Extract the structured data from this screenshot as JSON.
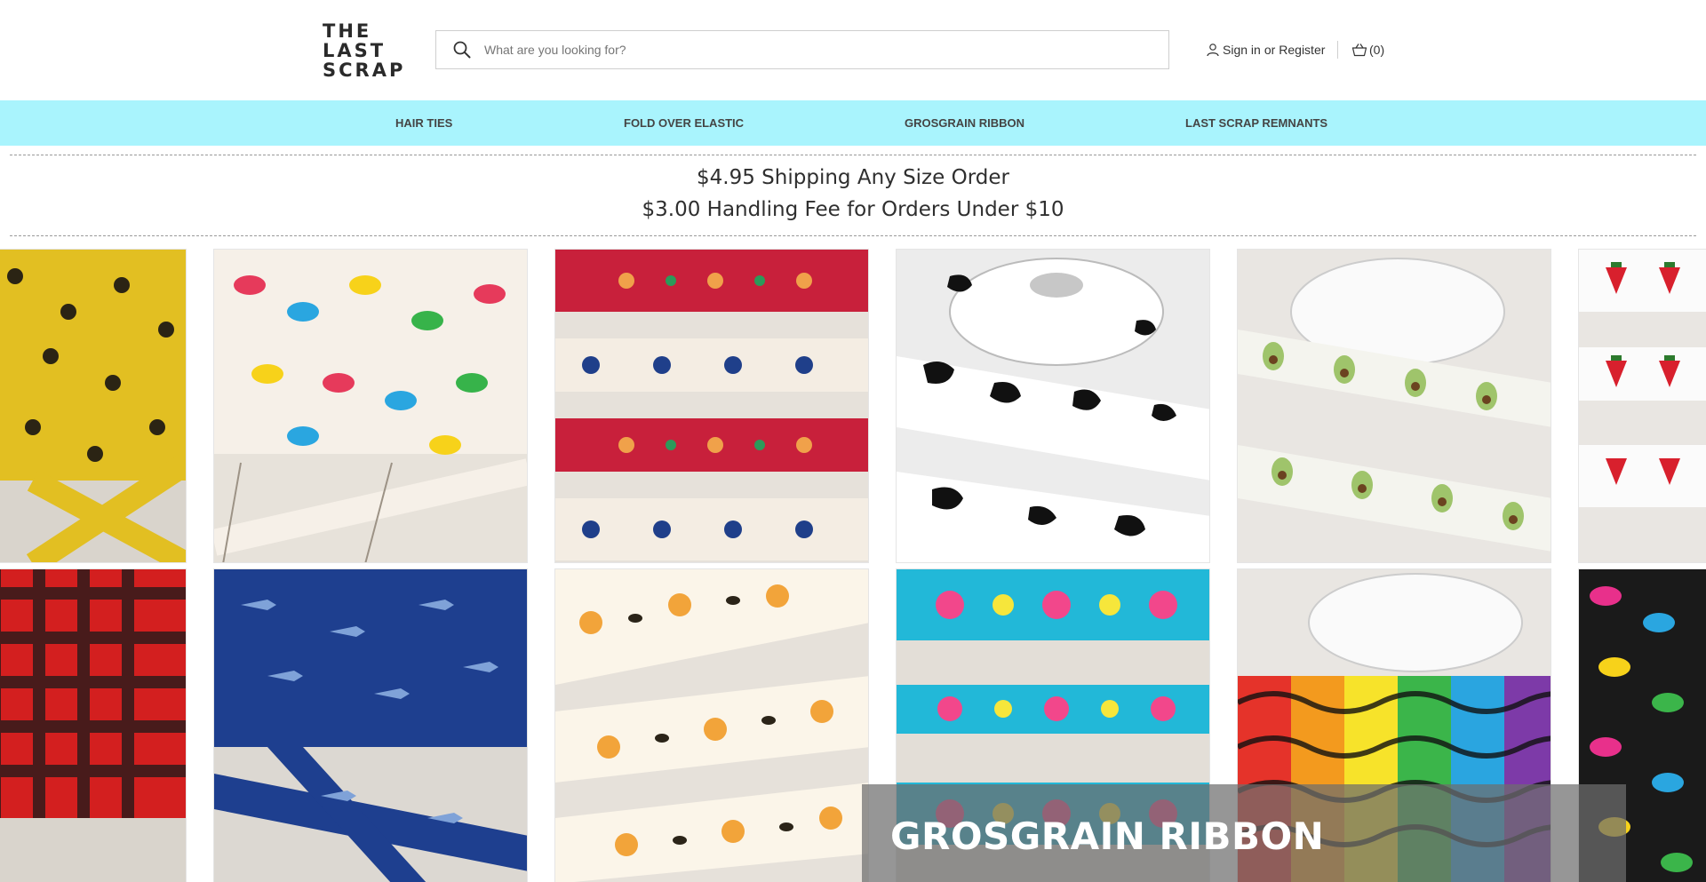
{
  "brand": {
    "logo_lines": [
      "THE",
      "LAST",
      "SCRAP"
    ]
  },
  "search": {
    "placeholder": "What are you looking for?",
    "icon": "search-icon"
  },
  "account": {
    "icon": "user-icon",
    "sign_in": "Sign in",
    "or": "or",
    "register": "Register"
  },
  "cart": {
    "icon": "basket-icon",
    "count_label": "(0)"
  },
  "nav": {
    "background": "#a9f4fd",
    "items": [
      {
        "label": "Hair Ties"
      },
      {
        "label": "Fold Over Elastic"
      },
      {
        "label": "Grosgrain Ribbon"
      },
      {
        "label": "Last Scrap Remnants"
      }
    ]
  },
  "banner": {
    "line1": "$4.95 Shipping   Any Size Order",
    "line2": "$3.00 Handling Fee for Orders Under $10"
  },
  "products": [
    {
      "pattern": "sunflowers",
      "colors": [
        "#e7c21d",
        "#2b2414",
        "#8a6a1c"
      ]
    },
    {
      "pattern": "colorful leopard",
      "colors": [
        "#f6f0e8",
        "#e63a5b",
        "#2aa6e0",
        "#f7d21a",
        "#37b34a"
      ]
    },
    {
      "pattern": "folk floral",
      "colors": [
        "#c8203b",
        "#1f3f8a",
        "#f0a14a",
        "#2c9a5a"
      ]
    },
    {
      "pattern": "cow print",
      "colors": [
        "#ffffff",
        "#111111"
      ]
    },
    {
      "pattern": "avocado",
      "colors": [
        "#f4f4ee",
        "#9fc46b",
        "#6b4320",
        "#1e1e1e"
      ]
    },
    {
      "pattern": "strawberry",
      "colors": [
        "#fbfbfb",
        "#d8202d",
        "#2d7a2d",
        "#f09a3c"
      ]
    },
    {
      "pattern": "buffalo plaid",
      "colors": [
        "#d31f1f",
        "#1a1a1a"
      ]
    },
    {
      "pattern": "shark",
      "colors": [
        "#1e3f8f",
        "#7fa2d8"
      ]
    },
    {
      "pattern": "bees and flowers",
      "colors": [
        "#fbf5e9",
        "#f2a43a",
        "#2b2418",
        "#f7c949"
      ]
    },
    {
      "pattern": "flamingo tropical",
      "colors": [
        "#22b8d8",
        "#f2478b",
        "#f6e63b",
        "#34a64a"
      ]
    },
    {
      "pattern": "rainbow zebra",
      "colors": [
        "#e5332a",
        "#f39a1e",
        "#f7e32a",
        "#3bb54a",
        "#2aa5e0",
        "#7d3aa8"
      ]
    },
    {
      "pattern": "rainbow leopard",
      "colors": [
        "#e8308b",
        "#2aa6e0",
        "#f7d21a",
        "#3bb54a",
        "#111111"
      ]
    }
  ],
  "caption": {
    "title": "GROSGRAIN RIBBON"
  }
}
